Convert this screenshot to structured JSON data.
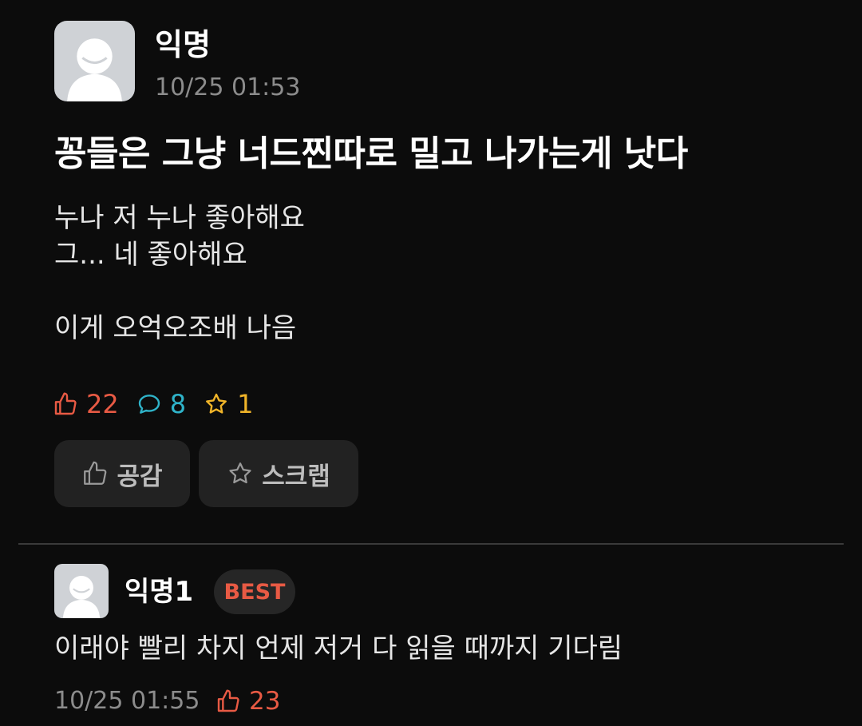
{
  "post": {
    "author": "익명",
    "time": "10/25 01:53",
    "title": "꽁들은 그냥 너드찐따로 밀고 나가는게 낫다",
    "body_lines": [
      "누나 저 누나 좋아해요",
      "그... 네 좋아해요",
      "",
      "이게 오억오조배 나음"
    ],
    "stats": {
      "likes": "22",
      "comments": "8",
      "scraps": "1"
    },
    "actions": {
      "like_label": "공감",
      "scrap_label": "스크랩"
    }
  },
  "comment": {
    "author": "익명1",
    "badge": "BEST",
    "body": "이래야 빨리 차지 언제 저거 다 읽을 때까지 기다림",
    "time": "10/25 01:55",
    "likes": "23"
  },
  "colors": {
    "like": "#e85a44",
    "comment": "#2fb3c9",
    "scrap": "#f0b429",
    "background": "#0c0c0c",
    "button_bg": "#222222"
  },
  "icons": [
    "avatar-icon",
    "thumbs-up-icon",
    "comment-bubble-icon",
    "star-icon"
  ]
}
